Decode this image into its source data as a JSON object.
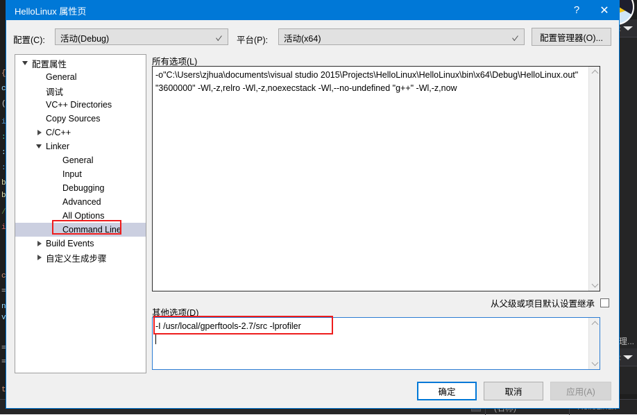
{
  "backdrop": {
    "app": "visual-studio",
    "right_panel_label": "管理...",
    "propgrid": {
      "name_cell": "(名称)",
      "value_cell": "HelloLinux"
    },
    "code_ghost_lines": [
      "{",
      "c",
      "(",
      "i",
      ":",
      ":",
      ":",
      "b",
      "b",
      "/",
      "i",
      "",
      "c",
      "=",
      "n",
      "v",
      "",
      "=",
      "=",
      "",
      "t"
    ]
  },
  "dialog": {
    "title": "HelloLinux 属性页",
    "help_button": "?",
    "close_button": "✕",
    "config": {
      "label": "配置(C):",
      "value": "活动(Debug)"
    },
    "platform": {
      "label": "平台(P):",
      "value": "活动(x64)"
    },
    "config_manager_button": "配置管理器(O)...",
    "tree": [
      {
        "label": "配置属性",
        "indent": 8,
        "arrow": "expanded",
        "selected": false
      },
      {
        "label": "General",
        "indent": 44,
        "arrow": "none",
        "selected": false
      },
      {
        "label": "调试",
        "indent": 44,
        "arrow": "none",
        "selected": false
      },
      {
        "label": "VC++ Directories",
        "indent": 44,
        "arrow": "none",
        "selected": false
      },
      {
        "label": "Copy Sources",
        "indent": 44,
        "arrow": "none",
        "selected": false
      },
      {
        "label": "C/C++",
        "indent": 44,
        "arrow": "collapsed",
        "selected": false
      },
      {
        "label": "Linker",
        "indent": 44,
        "arrow": "expanded",
        "selected": false
      },
      {
        "label": "General",
        "indent": 68,
        "arrow": "none",
        "selected": false
      },
      {
        "label": "Input",
        "indent": 68,
        "arrow": "none",
        "selected": false
      },
      {
        "label": "Debugging",
        "indent": 68,
        "arrow": "none",
        "selected": false
      },
      {
        "label": "Advanced",
        "indent": 68,
        "arrow": "none",
        "selected": false
      },
      {
        "label": "All Options",
        "indent": 68,
        "arrow": "none",
        "selected": false
      },
      {
        "label": "Command Line",
        "indent": 68,
        "arrow": "none",
        "selected": true
      },
      {
        "label": "Build Events",
        "indent": 44,
        "arrow": "collapsed",
        "selected": false
      },
      {
        "label": "自定义生成步骤",
        "indent": 44,
        "arrow": "collapsed",
        "selected": false
      }
    ],
    "all_options": {
      "label": "所有选项(L)",
      "value": "-o\"C:\\Users\\zjhua\\documents\\visual studio 2015\\Projects\\HelloLinux\\HelloLinux\\bin\\x64\\Debug\\HelloLinux.out\" \"3600000\" -Wl,-z,relro -Wl,-z,noexecstack -Wl,--no-undefined \"g++\" -Wl,-z,now"
    },
    "inherit": {
      "label": "从父级或项目默认设置继承",
      "checked": false
    },
    "additional_options": {
      "label": "其他选项(D)",
      "value": "-I /usr/local/gperftools-2.7/src -lprofiler"
    },
    "buttons": {
      "ok": "确定",
      "cancel": "取消",
      "apply": "应用(A)"
    },
    "highlight_color": "#ee1c1c",
    "accent_color": "#0078d7"
  }
}
